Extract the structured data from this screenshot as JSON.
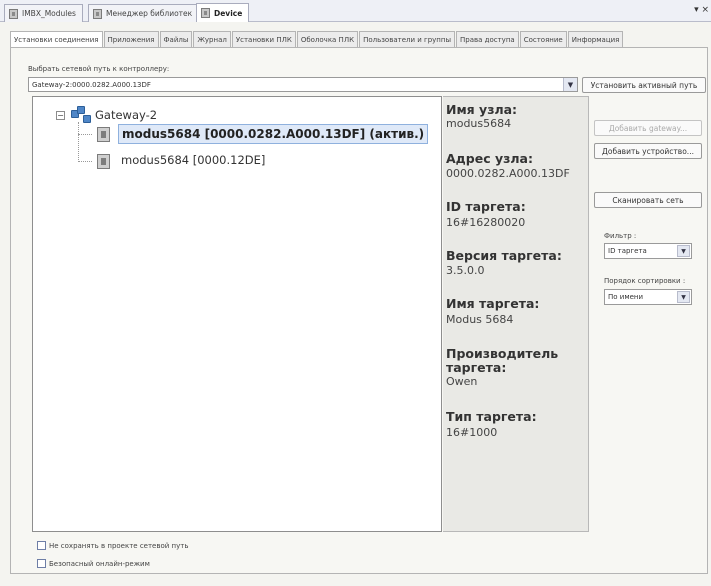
{
  "document_tabs": [
    {
      "label": "IMBX_Modules"
    },
    {
      "label": "Менеджер библиотек"
    },
    {
      "label": "Device"
    }
  ],
  "document_tabs_menu_glyph": "▾ ×",
  "config_tabs": [
    {
      "label": "Установки соединения"
    },
    {
      "label": "Приложения"
    },
    {
      "label": "Файлы"
    },
    {
      "label": "Журнал"
    },
    {
      "label": "Установки ПЛК"
    },
    {
      "label": "Оболочка ПЛК"
    },
    {
      "label": "Пользователи и группы"
    },
    {
      "label": "Права доступа"
    },
    {
      "label": "Состояние"
    },
    {
      "label": "Информация"
    }
  ],
  "connection": {
    "path_label": "Выбрать сетевой путь к контроллеру:",
    "path_value": "Gateway-2:0000.0282.A000.13DF",
    "set_active_path_button": "Установить активный путь"
  },
  "tree": {
    "expander_glyph": "−",
    "gateway": {
      "label": "Gateway-2"
    },
    "nodes": [
      {
        "label": "modus5684 [0000.0282.A000.13DF] (актив.)"
      },
      {
        "label": "modus5684 [0000.12DE]"
      }
    ]
  },
  "info": [
    {
      "label": "Имя узла:",
      "value": "modus5684"
    },
    {
      "label": "Адрес узла:",
      "value": "0000.0282.A000.13DF"
    },
    {
      "label": "ID таргета:",
      "value": "16#16280020"
    },
    {
      "label": "Версия таргета:",
      "value": "3.5.0.0"
    },
    {
      "label": "Имя таргета:",
      "value": "Modus 5684"
    },
    {
      "label": "Производитель таргета:",
      "value": "Owen"
    },
    {
      "label": "Тип таргета:",
      "value": "16#1000"
    }
  ],
  "actions": {
    "add_gateway": "Добавить gateway...",
    "add_device": "Добавить устройство...",
    "scan_network": "Сканировать сеть"
  },
  "filter": {
    "label": "Фильтр :",
    "value": "ID таргета"
  },
  "sort": {
    "label": "Порядок сортировки :",
    "value": "По имени"
  },
  "dropdown_glyph": "▼",
  "checkboxes": [
    {
      "label": "Не сохранять в проекте сетевой путь",
      "checked": false
    },
    {
      "label": "Безопасный онлайн-режим",
      "checked": false
    }
  ]
}
